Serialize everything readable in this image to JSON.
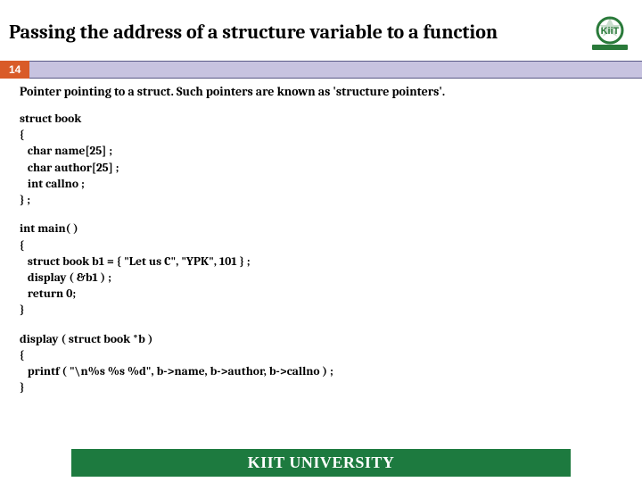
{
  "slide": {
    "title": "Passing the address of a structure variable to a function",
    "page_number": "14",
    "intro": "Pointer pointing to a struct. Such pointers are known as 'structure pointers'.",
    "code1": "struct book\n{\n   char name[25] ;\n   char author[25] ;\n   int callno ;\n} ;",
    "code2": "int main( )\n{\n   struct book b1 = { \"Let us C\", \"YPK\", 101 } ;\n   display ( &b1 ) ;\n   return 0;\n}",
    "code3": "display ( struct book *b )\n{\n   printf ( \"\\n%s %s %d\", b->name, b->author, b->callno ) ;\n}",
    "footer": "KIIT UNIVERSITY",
    "logo_text": "KiiT"
  }
}
